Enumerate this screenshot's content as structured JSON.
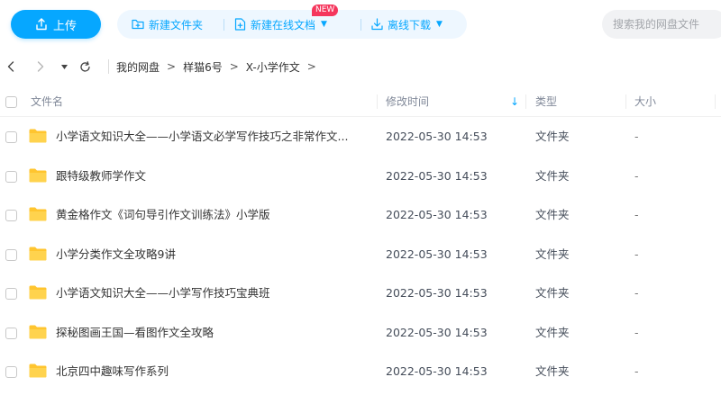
{
  "toolbar": {
    "upload_label": "上传",
    "new_folder_label": "新建文件夹",
    "new_online_doc_label": "新建在线文档",
    "new_badge": "NEW",
    "offline_download_label": "离线下载",
    "search_placeholder": "搜索我的网盘文件",
    "accent_color": "#06a7ff"
  },
  "nav": {
    "back_icon": "chevron-left-icon",
    "forward_icon": "chevron-right-icon",
    "dropdown_icon": "triangle-down-icon",
    "refresh_icon": "refresh-icon",
    "breadcrumbs": [
      "我的网盘",
      "样猫6号",
      "X-小学作文"
    ],
    "separator": ">"
  },
  "table": {
    "columns": {
      "name": "文件名",
      "modified": "修改时间",
      "type": "类型",
      "size": "大小"
    },
    "sort_indicator": "↓",
    "rows": [
      {
        "name": "小学语文知识大全——小学语文必学写作技巧之非常作文...",
        "modified": "2022-05-30 14:53",
        "type": "文件夹",
        "size": "-"
      },
      {
        "name": "跟特级教师学作文",
        "modified": "2022-05-30 14:53",
        "type": "文件夹",
        "size": "-"
      },
      {
        "name": "黄金格作文《词句导引作文训练法》小学版",
        "modified": "2022-05-30 14:53",
        "type": "文件夹",
        "size": "-"
      },
      {
        "name": "小学分类作文全攻略9讲",
        "modified": "2022-05-30 14:53",
        "type": "文件夹",
        "size": "-"
      },
      {
        "name": "小学语文知识大全——小学写作技巧宝典班",
        "modified": "2022-05-30 14:53",
        "type": "文件夹",
        "size": "-"
      },
      {
        "name": "探秘图画王国—看图作文全攻略",
        "modified": "2022-05-30 14:53",
        "type": "文件夹",
        "size": "-"
      },
      {
        "name": "北京四中趣味写作系列",
        "modified": "2022-05-30 14:53",
        "type": "文件夹",
        "size": "-"
      }
    ]
  }
}
